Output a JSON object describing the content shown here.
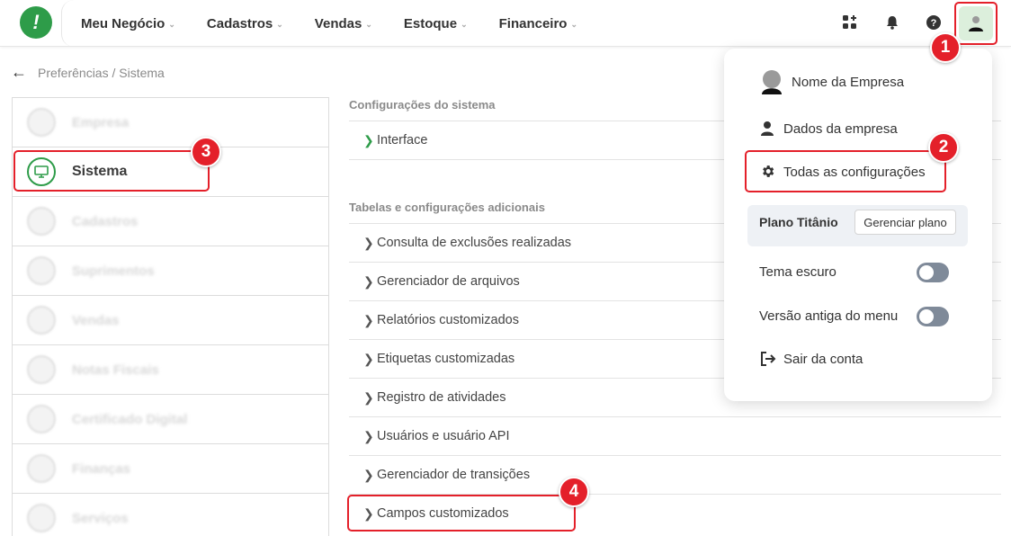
{
  "nav": {
    "items": [
      {
        "label": "Meu Negócio"
      },
      {
        "label": "Cadastros"
      },
      {
        "label": "Vendas"
      },
      {
        "label": "Estoque"
      },
      {
        "label": "Financeiro"
      }
    ]
  },
  "breadcrumb": {
    "text": "Preferências / Sistema"
  },
  "sidebar": {
    "items": [
      {
        "label": "Empresa"
      },
      {
        "label": "Sistema"
      },
      {
        "label": "Cadastros"
      },
      {
        "label": "Suprimentos"
      },
      {
        "label": "Vendas"
      },
      {
        "label": "Notas Fiscais"
      },
      {
        "label": "Certificado Digital"
      },
      {
        "label": "Finanças"
      },
      {
        "label": "Serviços"
      }
    ]
  },
  "main": {
    "section1": {
      "title": "Configurações do sistema",
      "rows": [
        "Interface"
      ]
    },
    "section2": {
      "title": "Tabelas e configurações adicionais",
      "rows": [
        "Consulta de exclusões realizadas",
        "Gerenciador de arquivos",
        "Relatórios customizados",
        "Etiquetas customizadas",
        "Registro de atividades",
        "Usuários e usuário API",
        "Gerenciador de transições",
        "Campos customizados"
      ]
    }
  },
  "dropdown": {
    "company_name": "Nome da Empresa",
    "company_data": "Dados da empresa",
    "all_settings": "Todas as configurações",
    "plan_name": "Plano Titânio",
    "manage_plan": "Gerenciar plano",
    "dark_theme": "Tema escuro",
    "old_menu": "Versão antiga do menu",
    "logout": "Sair da conta"
  },
  "callouts": [
    "1",
    "2",
    "3",
    "4"
  ],
  "colors": {
    "brand_green": "#2e9c49",
    "callout_red": "#e4202a",
    "toggle_off": "#7f8a99"
  }
}
